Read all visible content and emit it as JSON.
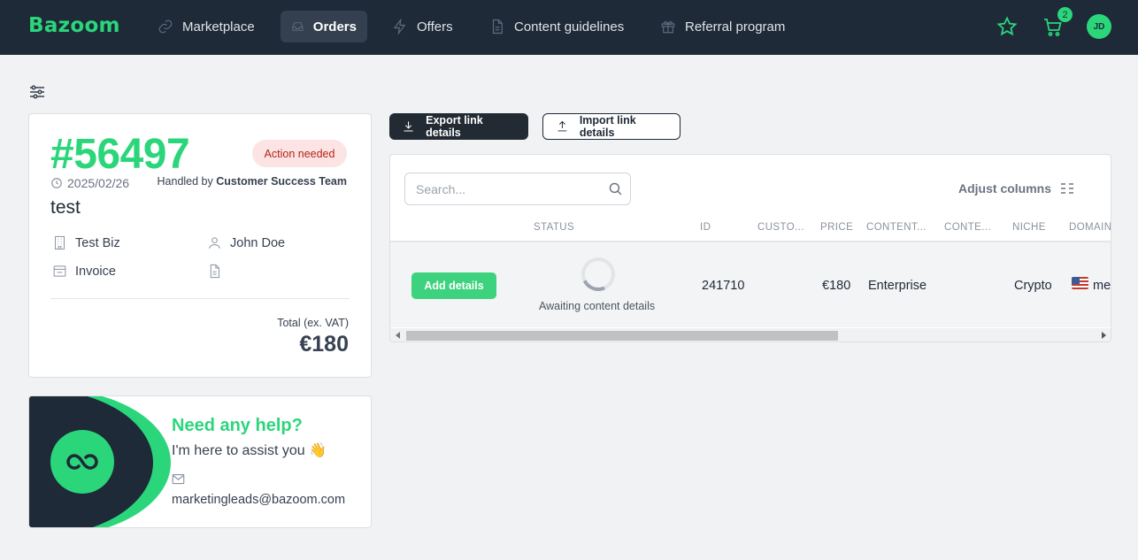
{
  "nav": {
    "logo": "Bazoom",
    "items": [
      {
        "label": "Marketplace",
        "icon": "link-icon"
      },
      {
        "label": "Orders",
        "icon": "inbox-icon",
        "active": true
      },
      {
        "label": "Offers",
        "icon": "lightning-icon"
      },
      {
        "label": "Content guidelines",
        "icon": "document-icon"
      },
      {
        "label": "Referral program",
        "icon": "gift-icon"
      }
    ],
    "cart_count": "2",
    "avatar_initials": "JD"
  },
  "order": {
    "number": "#56497",
    "status": "Action needed",
    "date": "2025/02/26",
    "handled_prefix": "Handled by",
    "handled_by": "Customer Success Team",
    "title": "test",
    "company": "Test Biz",
    "contact": "John Doe",
    "billing": "Invoice",
    "total_label": "Total (ex. VAT)",
    "total": "€180"
  },
  "help": {
    "title": "Need any help?",
    "subtitle": "I'm here to assist you 👋",
    "email": "marketingleads@bazoom.com"
  },
  "toolbar": {
    "export_label": "Export link details",
    "import_label": "Import link details"
  },
  "table": {
    "search_placeholder": "Search...",
    "adjust_label": "Adjust columns",
    "headers": [
      "STATUS",
      "ID",
      "CUSTO...",
      "PRICE",
      "CONTENT...",
      "CONTE...",
      "NICHE",
      "DOMAIN"
    ],
    "row": {
      "action": "Add details",
      "status": "Awaiting content details",
      "id": "241710",
      "customer": "",
      "price": "€180",
      "content_type": "Enterprise",
      "content": "",
      "niche": "Crypto",
      "domain": "me"
    }
  },
  "colors": {
    "brand": "#2bd67b",
    "nav_bg": "#1e2a38",
    "alert_bg": "#fce4e4",
    "alert_text": "#b42318"
  }
}
